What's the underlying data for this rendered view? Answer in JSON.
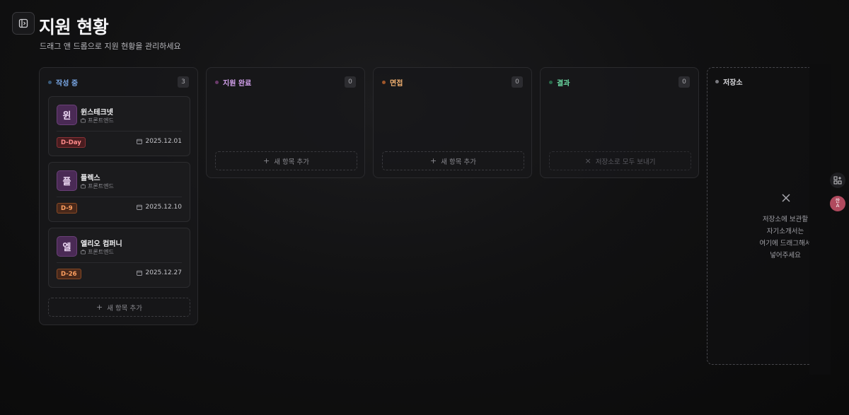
{
  "header": {
    "title": "지원 현황",
    "subtitle": "드래그 앤 드롭으로 지원 현황을 관리하세요"
  },
  "columns": [
    {
      "title": "작성 중",
      "count": "3",
      "dot_color": "#3a5a7a",
      "title_color": "#7aa8e6",
      "cards": [
        {
          "avatar": "윈",
          "company": "윈스테크넷",
          "role": "프론트엔드",
          "badge": "D-Day",
          "badge_style": "red",
          "date": "2025.12.01"
        },
        {
          "avatar": "플",
          "company": "플렉스",
          "role": "프론트엔드",
          "badge": "D-9",
          "badge_style": "orange",
          "date": "2025.12.10"
        },
        {
          "avatar": "엘",
          "company": "엘리오 컴퍼니",
          "role": "프론트엔드",
          "badge": "D-26",
          "badge_style": "orange",
          "date": "2025.12.27"
        }
      ],
      "action": "새 항목 추가"
    },
    {
      "title": "지원 완료",
      "count": "0",
      "dot_color": "#6a3a6a",
      "title_color": "#d6a3f0",
      "cards": [],
      "action": "새 항목 추가"
    },
    {
      "title": "면접",
      "count": "0",
      "dot_color": "#a0562a",
      "title_color": "#f0b070",
      "cards": [],
      "action": "새 항목 추가"
    },
    {
      "title": "결과",
      "count": "0",
      "dot_color": "#2a6a4a",
      "title_color": "#6ad6a0",
      "cards": [],
      "action": "저장소로 모두 보내기"
    }
  ],
  "storage": {
    "title": "저장소",
    "message_lines": [
      "저장소에 보관할",
      "자기소개서는",
      "여기에 드래그해서",
      "넣어주세요"
    ]
  },
  "side_buttons": [
    {
      "icon": "layout-icon"
    },
    {
      "icon": "translate-icon",
      "label": "한\nA"
    }
  ]
}
